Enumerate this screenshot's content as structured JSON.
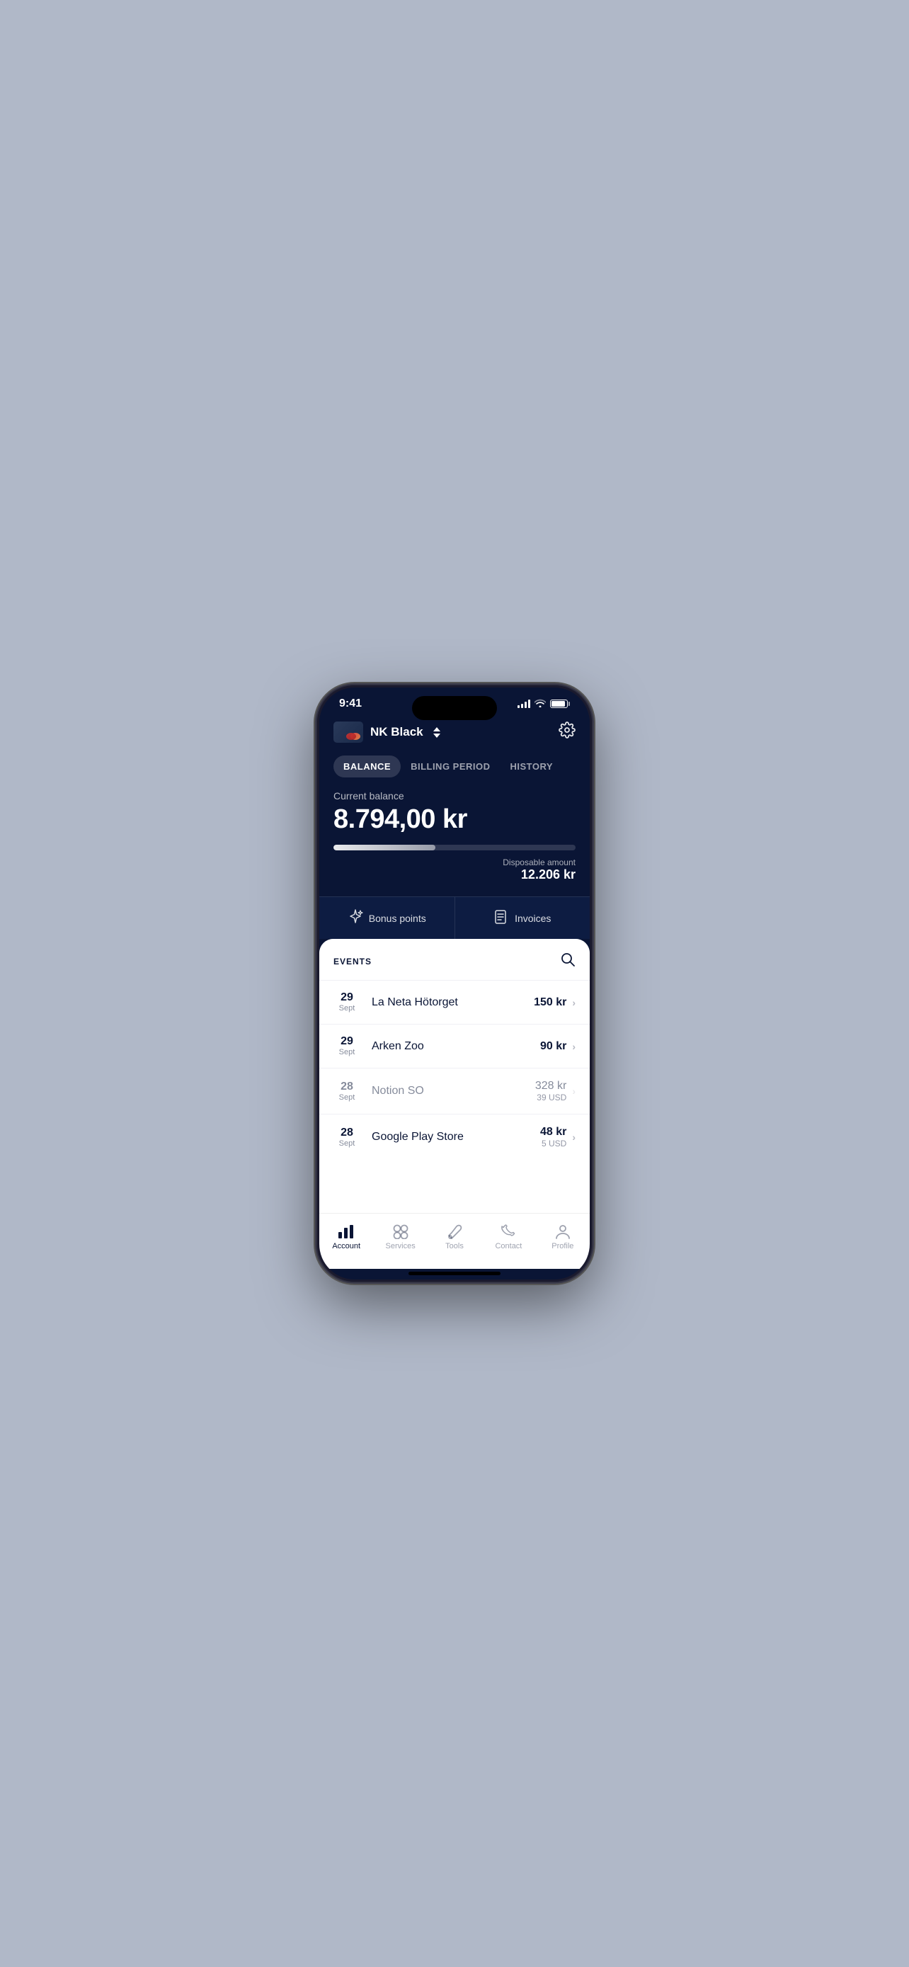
{
  "phone": {
    "status_bar": {
      "time": "9:41",
      "signal": "signal-icon",
      "wifi": "wifi-icon",
      "battery": "battery-icon"
    },
    "header": {
      "card_name": "NK Black",
      "settings_icon": "gear-icon"
    },
    "tabs": [
      {
        "label": "BALANCE",
        "active": true
      },
      {
        "label": "BILLING PERIOD",
        "active": false
      },
      {
        "label": "HISTORY",
        "active": false
      }
    ],
    "balance": {
      "label": "Current balance",
      "amount": "8.794,00 kr",
      "progress_percent": 42,
      "disposable_label": "Disposable amount",
      "disposable_amount": "12.206 kr"
    },
    "quick_actions": [
      {
        "icon": "sparkle-icon",
        "label": "Bonus points"
      },
      {
        "icon": "invoice-icon",
        "label": "Invoices"
      }
    ],
    "events": {
      "section_title": "EVENTS",
      "search_icon": "search-icon",
      "transactions": [
        {
          "day": "29",
          "month": "Sept",
          "name": "La Neta Hötorget",
          "amount": "150 kr",
          "sub_amount": null,
          "dimmed": false
        },
        {
          "day": "29",
          "month": "Sept",
          "name": "Arken Zoo",
          "amount": "90 kr",
          "sub_amount": null,
          "dimmed": false
        },
        {
          "day": "28",
          "month": "Sept",
          "name": "Notion SO",
          "amount": "328 kr",
          "sub_amount": "39 USD",
          "dimmed": true
        },
        {
          "day": "28",
          "month": "Sept",
          "name": "Google Play Store",
          "amount": "48 kr",
          "sub_amount": "5 USD",
          "dimmed": false
        }
      ]
    },
    "bottom_nav": [
      {
        "icon": "bar-chart-icon",
        "label": "Account",
        "active": true
      },
      {
        "icon": "services-icon",
        "label": "Services",
        "active": false
      },
      {
        "icon": "tools-icon",
        "label": "Tools",
        "active": false
      },
      {
        "icon": "contact-icon",
        "label": "Contact",
        "active": false
      },
      {
        "icon": "profile-icon",
        "label": "Profile",
        "active": false
      }
    ]
  }
}
